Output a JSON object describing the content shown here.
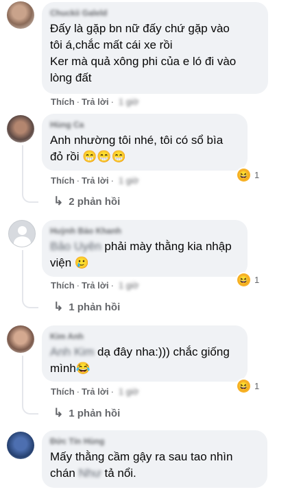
{
  "comments": [
    {
      "author": "Chuckii Galeld",
      "lines": [
        "Đấy là gặp bn nữ đấy chứ gặp vào",
        "tôi á,chắc mất cái xe rồi",
        "Ker mà quả xông phi của e ló đi vào",
        "lòng đất"
      ],
      "like": "Thích",
      "reply": "Trả lời",
      "time": "1 giờ"
    },
    {
      "author": "Hùng Ca",
      "lines": [
        "Anh nhường tôi nhé, tôi có sổ bìa",
        "đỏ rồi 😁😁😁"
      ],
      "like": "Thích",
      "reply": "Trả lời",
      "time": "1 giờ",
      "reaction": {
        "emoji": "😆",
        "count": "1"
      },
      "replies": "2 phản hồi"
    },
    {
      "author": "Huỳnh Bảo Khanh",
      "mention": "Bảo Uyên",
      "lines": [
        "phải mày thằng kia nhập",
        "viện 🥲"
      ],
      "like": "Thích",
      "reply": "Trả lời",
      "time": "1 giờ",
      "reaction": {
        "emoji": "😆",
        "count": "1"
      },
      "replies": "1 phản hồi"
    },
    {
      "author": "Kim Anh",
      "mention": "Anh Kim",
      "lines": [
        "dạ đây nha:))) chắc giống",
        "mình😂"
      ],
      "like": "Thích",
      "reply": "Trả lời",
      "time": "1 giờ",
      "reaction": {
        "emoji": "😆",
        "count": "1"
      },
      "replies": "1 phản hồi"
    },
    {
      "author": "Đức Tín Hùng",
      "lines": [
        "Mấy thằng cầm gậy ra sau tao nhìn",
        "chán"
      ],
      "mention": "Như",
      "tail": "tả nổi."
    }
  ]
}
